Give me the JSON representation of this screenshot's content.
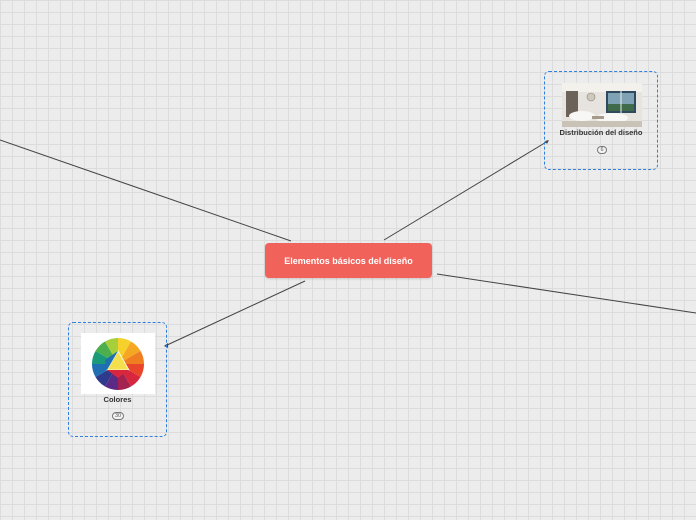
{
  "central_topic": {
    "label": "Elementos básicos del diseño",
    "color": "#f0625a"
  },
  "nodes": [
    {
      "title": "Distribución del diseño",
      "count": "6",
      "image": "room-photo",
      "border_color": "#2f80de"
    },
    {
      "title": "Colores",
      "count": "30",
      "image": "color-wheel",
      "border_color": "#2f80de"
    }
  ],
  "colors": {
    "canvas": "#ececec",
    "grid": "#dcdcdc",
    "link": "#444444"
  }
}
